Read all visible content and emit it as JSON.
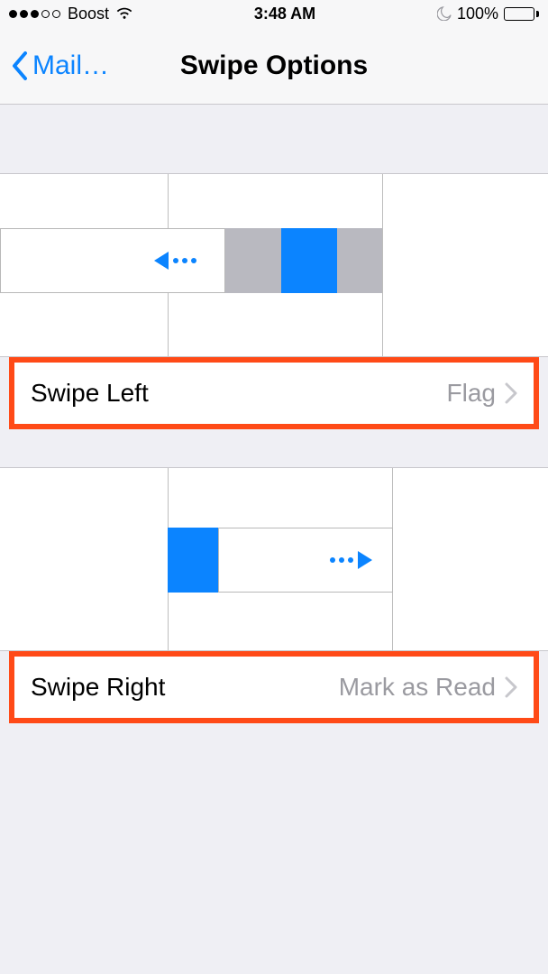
{
  "status": {
    "carrier": "Boost",
    "time": "3:48 AM",
    "battery_percent": "100%"
  },
  "nav": {
    "back_label": "Mail…",
    "title": "Swipe Options"
  },
  "swipe_left": {
    "label": "Swipe Left",
    "value": "Flag"
  },
  "swipe_right": {
    "label": "Swipe Right",
    "value": "Mark as Read"
  },
  "colors": {
    "accent_blue": "#0b84ff",
    "highlight_border": "#ff4a17",
    "gray_segment": "#b9b9c0",
    "background": "#efeff4"
  }
}
